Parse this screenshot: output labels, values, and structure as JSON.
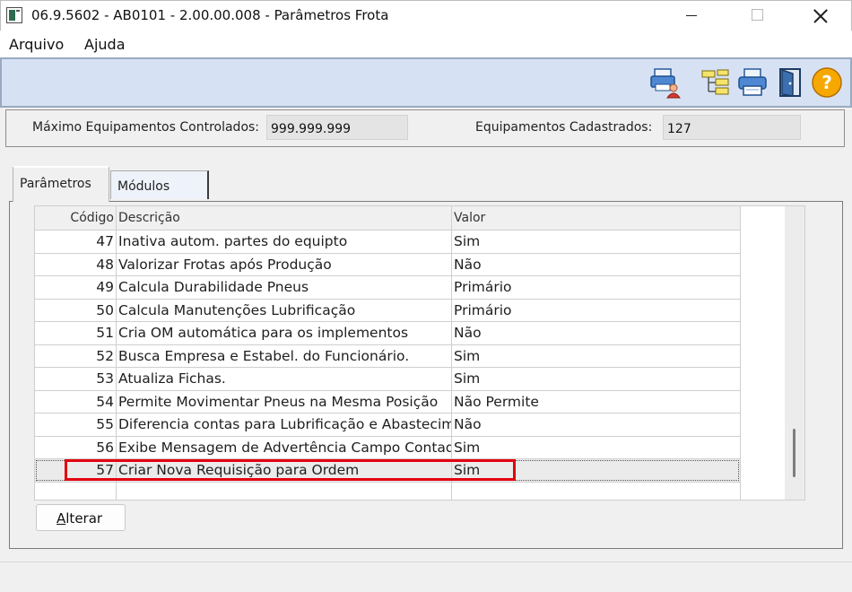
{
  "window": {
    "title": "06.9.5602 - AB0101 - 2.00.00.008 - Parâmetros Frota"
  },
  "menu": {
    "items": [
      "Arquivo",
      "Ajuda"
    ]
  },
  "toolbar": {
    "icons": [
      "print-user-icon",
      "hierarchy-icon",
      "printer-icon",
      "exit-door-icon",
      "help-icon"
    ]
  },
  "info": {
    "max_label": "Máximo Equipamentos Controlados:",
    "max_value": "999.999.999",
    "registered_label": "Equipamentos Cadastrados:",
    "registered_value": "127"
  },
  "tabs": [
    {
      "label": "Parâmetros",
      "active": true
    },
    {
      "label": "Módulos",
      "active": false
    }
  ],
  "grid": {
    "columns": [
      "Código",
      "Descrição",
      "Valor"
    ],
    "rows": [
      {
        "code": "47",
        "desc": "Inativa autom. partes do equipto",
        "value": "Sim"
      },
      {
        "code": "48",
        "desc": "Valorizar Frotas após Produção",
        "value": "Não"
      },
      {
        "code": "49",
        "desc": "Calcula Durabilidade Pneus",
        "value": "Primário"
      },
      {
        "code": "50",
        "desc": "Calcula Manutenções Lubrificação",
        "value": "Primário"
      },
      {
        "code": "51",
        "desc": "Cria OM automática para os implementos",
        "value": "Não"
      },
      {
        "code": "52",
        "desc": "Busca Empresa e Estabel. do Funcionário.",
        "value": "Sim"
      },
      {
        "code": "53",
        "desc": "Atualiza Fichas.",
        "value": "Sim"
      },
      {
        "code": "54",
        "desc": "Permite Movimentar Pneus na Mesma Posição",
        "value": "Não Permite"
      },
      {
        "code": "55",
        "desc": "Diferencia contas para Lubrificação e Abastecimento",
        "value": "Não"
      },
      {
        "code": "56",
        "desc": "Exibe Mensagem de Advertência Campo Contador",
        "value": "Sim"
      },
      {
        "code": "57",
        "desc": "Criar Nova Requisição para Ordem",
        "value": "Sim",
        "selected": true
      }
    ]
  },
  "buttons": {
    "alterar_first": "A",
    "alterar_rest": "lterar"
  },
  "colors": {
    "toolbar_bg": "#d6e2f4",
    "highlight": "#e3000f"
  }
}
